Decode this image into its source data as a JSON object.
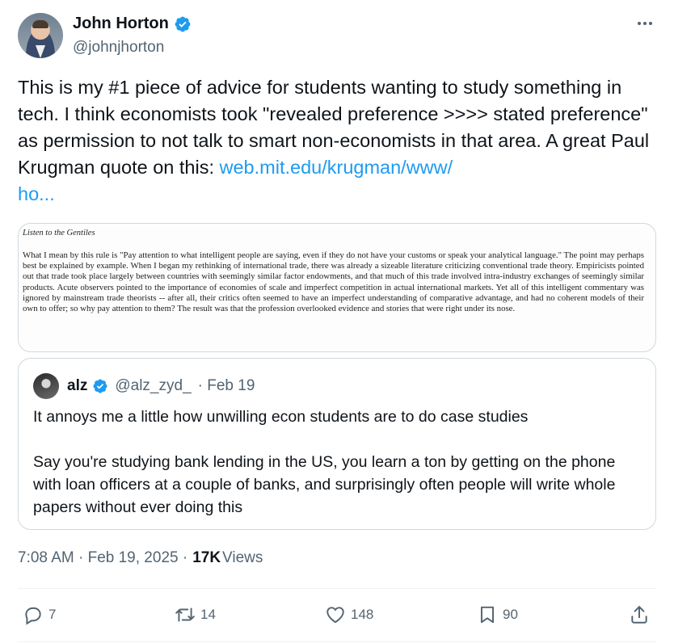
{
  "author": {
    "display_name": "John Horton",
    "handle": "@johnjhorton",
    "verified_icon": "verified-badge-icon"
  },
  "tweet": {
    "text": "This is my #1 piece of advice for students wanting to study something in tech. I think economists took \"revealed preference >>>> stated preference\" as permission to not talk to smart non-economists in that area. A great Paul Krugman quote on this: ",
    "link_text": "web.mit.edu/krugman/www/\nho..."
  },
  "image": {
    "title": "Listen to the Gentiles",
    "body": "What I mean by this rule is \"Pay attention to what intelligent people are saying, even if they do not have your customs or speak your analytical language.\" The point may perhaps best be explained by example. When I began my rethinking of international trade, there was already a sizeable literature criticizing conventional trade theory. Empiricists pointed out that trade took place largely between countries with seemingly similar factor endowments, and that much of this trade involved intra-industry exchanges of seemingly similar products. Acute observers pointed to the importance of economies of scale and imperfect competition in actual international markets. Yet all of this intelligent commentary was ignored by mainstream trade theorists -- after all, their critics often seemed to have an imperfect understanding of comparative advantage, and had no coherent models of their own to offer; so why pay attention to them? The result was that the profession overlooked evidence and stories that were right under its nose."
  },
  "quote": {
    "name": "alz",
    "handle": "@alz_zyd_",
    "date": "· Feb 19",
    "text": "It annoys me a little how unwilling econ students are to do case studies\n\nSay you're studying bank lending in the US, you learn a ton by getting on the phone with loan officers at a couple of banks, and surprisingly often people will write whole papers without ever doing this"
  },
  "meta": {
    "time": "7:08 AM · Feb 19, 2025 ·",
    "views_count": "17K",
    "views_label": "Views"
  },
  "actions": {
    "replies": "7",
    "reposts": "14",
    "likes": "148",
    "bookmarks": "90"
  },
  "colors": {
    "link": "#1d9bf0",
    "muted": "#536471",
    "text": "#0f1419",
    "border": "#cfd9de"
  }
}
